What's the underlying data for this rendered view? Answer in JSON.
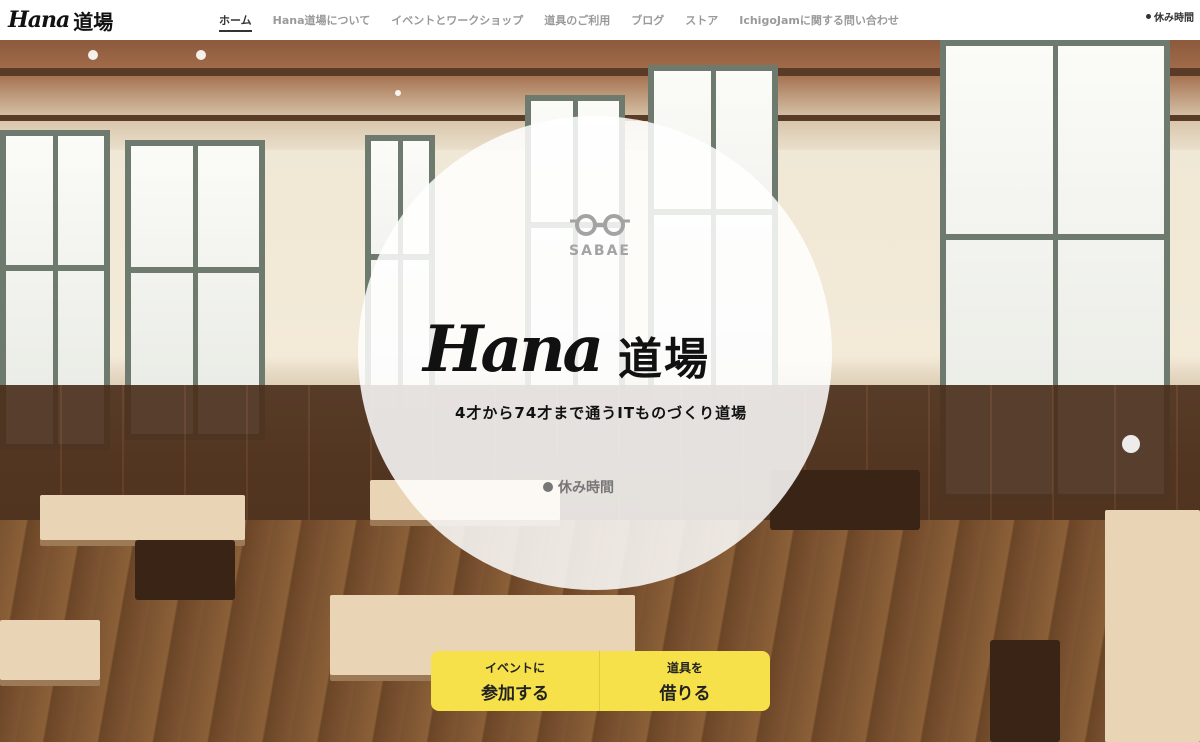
{
  "header": {
    "logo_script": "Hana",
    "logo_kanji": "道場",
    "nav": [
      {
        "label": "ホーム",
        "active": true
      },
      {
        "label": "Hana道場について",
        "active": false
      },
      {
        "label": "イベントとワークショップ",
        "active": false
      },
      {
        "label": "道具のご利用",
        "active": false
      },
      {
        "label": "ブログ",
        "active": false
      },
      {
        "label": "ストア",
        "active": false
      },
      {
        "label": "IchigoJamに関する問い合わせ",
        "active": false
      }
    ],
    "status": "休み時間"
  },
  "hero": {
    "sabae_label": "SABAE",
    "title_script": "Hana",
    "title_kanji": "道場",
    "tagline": "4才から74才まで通うITものづくり道場",
    "status": "休み時間"
  },
  "cta": {
    "event_small": "イベントに",
    "event_big": "参加する",
    "tools_small": "道具を",
    "tools_big": "借りる"
  },
  "colors": {
    "accent_yellow": "#f7e14a",
    "nav_text": "#9a9a9a",
    "nav_active": "#333333"
  }
}
